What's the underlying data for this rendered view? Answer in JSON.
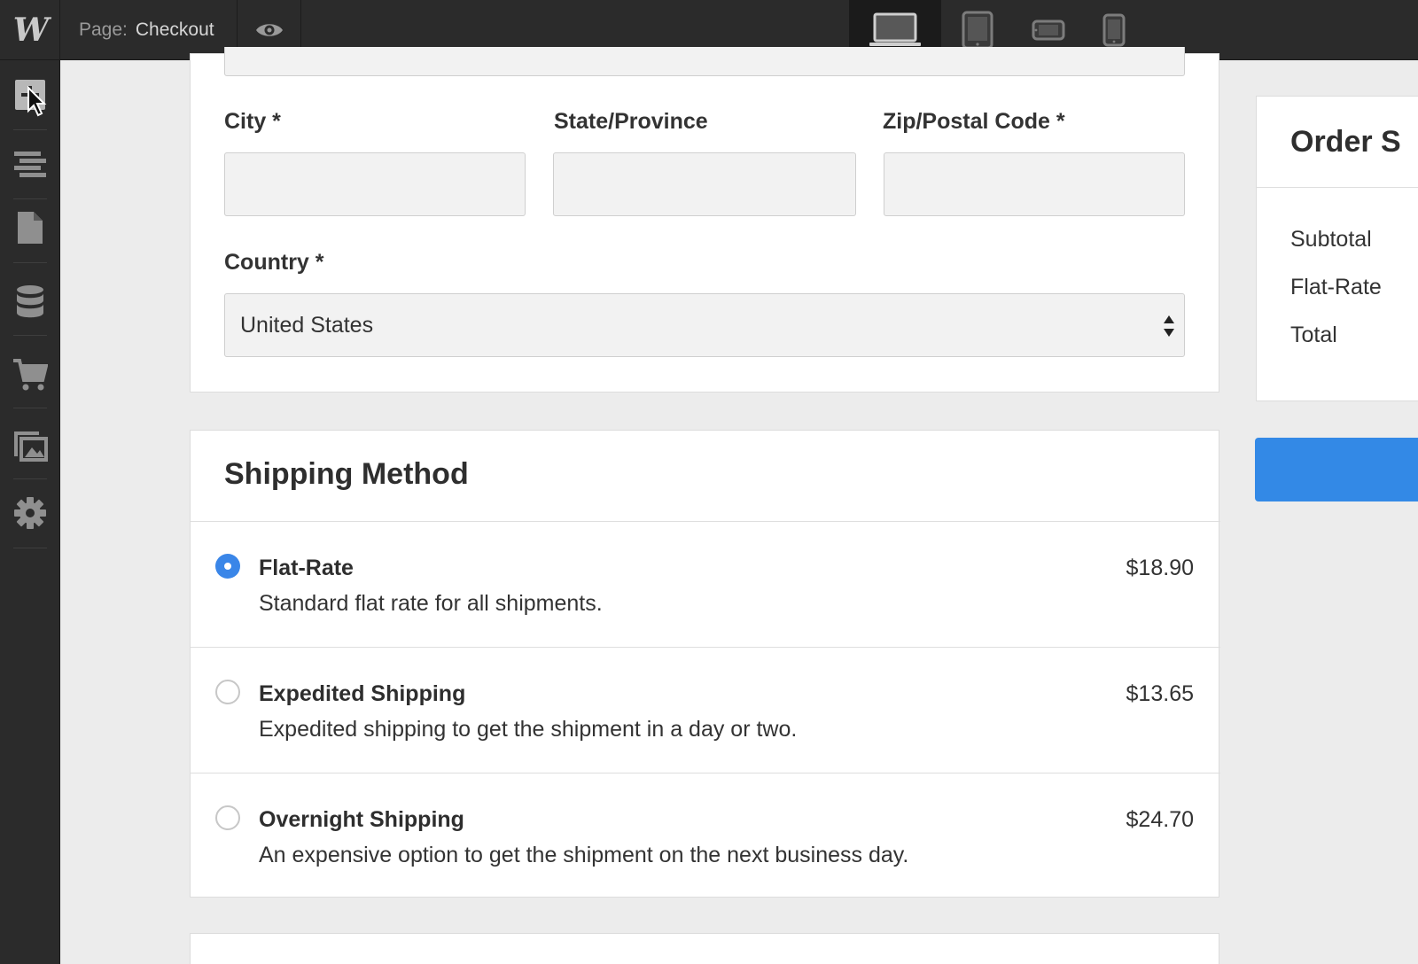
{
  "topbar": {
    "logo": "W",
    "page_prefix": "Page:",
    "page_name": "Checkout"
  },
  "sidebar": {
    "items": [
      "add-elements-icon",
      "navigator-icon",
      "pages-icon",
      "cms-icon",
      "ecommerce-icon",
      "assets-icon",
      "settings-icon"
    ]
  },
  "address": {
    "city_label": "City *",
    "state_label": "State/Province",
    "zip_label": "Zip/Postal Code *",
    "country_label": "Country *",
    "country_value": "United States"
  },
  "shipping": {
    "title": "Shipping Method",
    "options": [
      {
        "name": "Flat-Rate",
        "description": "Standard flat rate for all shipments.",
        "price": "$18.90",
        "selected": true
      },
      {
        "name": "Expedited Shipping",
        "description": "Expedited shipping to get the shipment in a day or two.",
        "price": "$13.65",
        "selected": false
      },
      {
        "name": "Overnight Shipping",
        "description": "An expensive option to get the shipment on the next business day.",
        "price": "$24.70",
        "selected": false
      }
    ]
  },
  "order_summary": {
    "title": "Order S",
    "lines": [
      "Subtotal",
      "Flat-Rate",
      "Total"
    ]
  },
  "colors": {
    "accent": "#3a86e8",
    "button": "#3389e6",
    "chrome": "#2b2b2b"
  }
}
